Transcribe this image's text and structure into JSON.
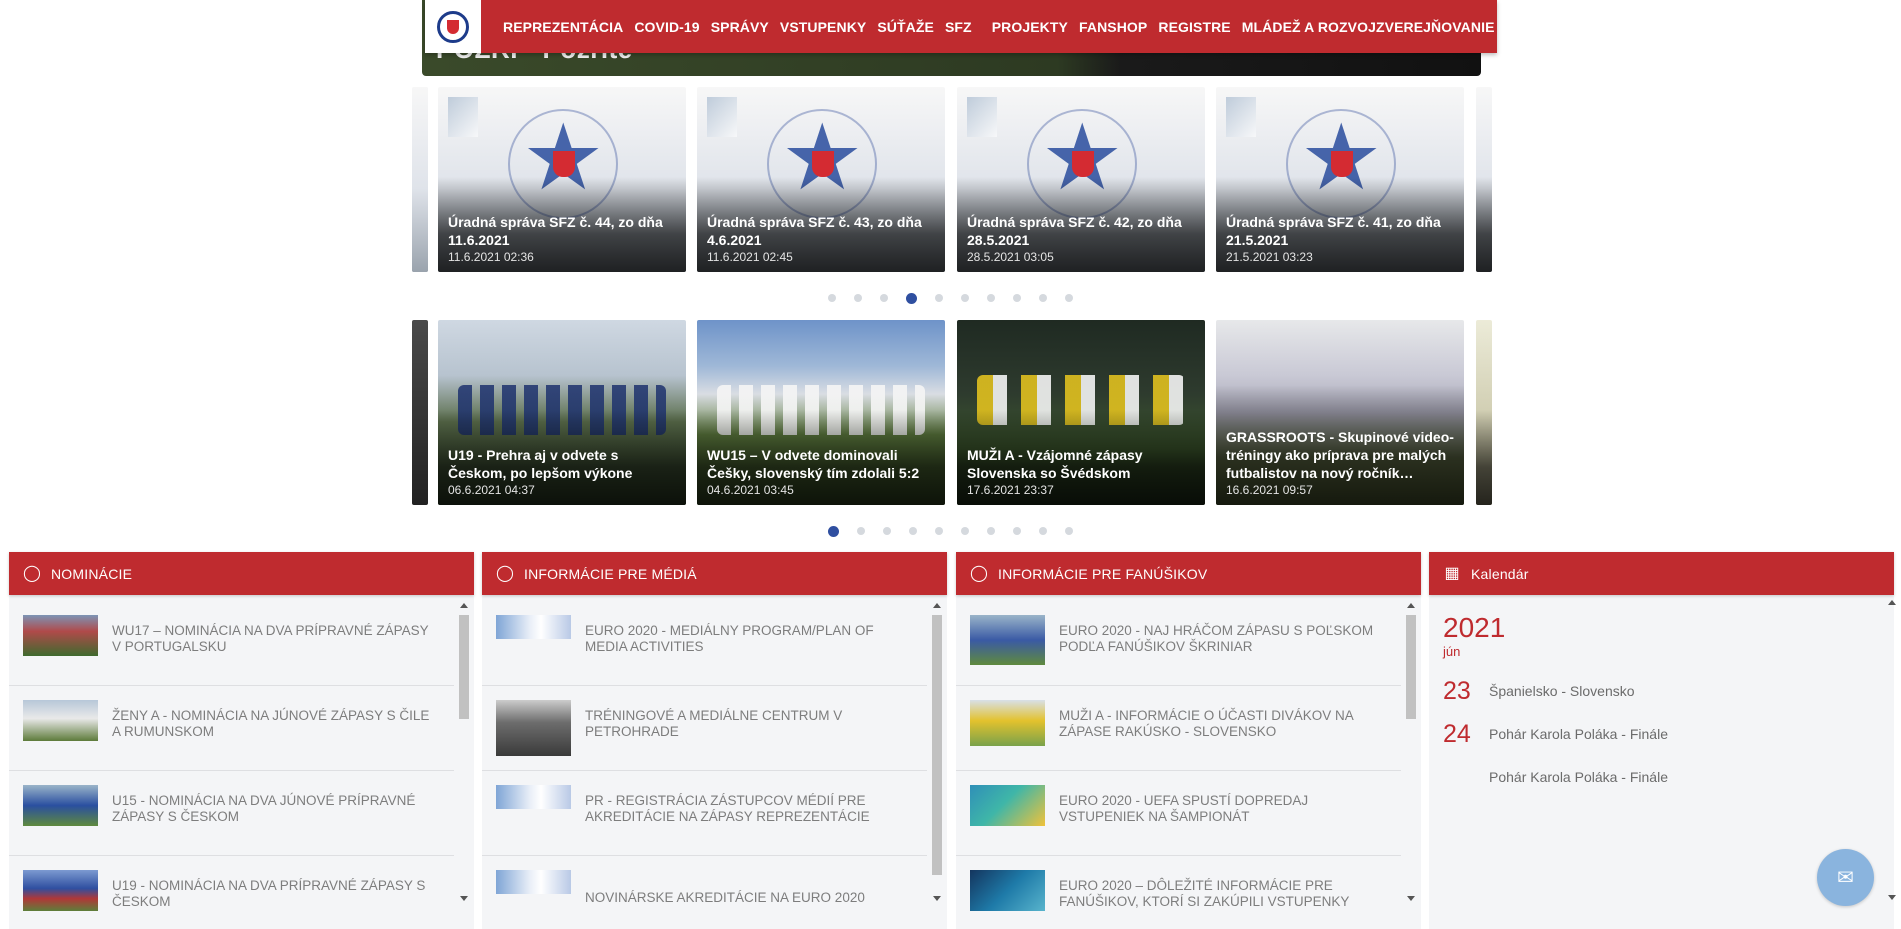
{
  "hero": {
    "text": "POZRI - Pozrite"
  },
  "nav": {
    "items": [
      "REPREZENTÁCIA",
      "COVID-19",
      "SPRÁVY",
      "VSTUPENKY",
      "SÚŤAŽE",
      "SFZ",
      "PROJEKTY",
      "FANSHOP",
      "REGISTRE",
      "MLÁDEŽ A ROZVOJ",
      "ZVEREJŇOVANIE"
    ]
  },
  "official_news": [
    {
      "title": "Úradná správa SFZ č. 44, zo dňa 11.6.2021",
      "date": "11.6.2021 02:36"
    },
    {
      "title": "Úradná správa SFZ č. 43, zo dňa 4.6.2021",
      "date": "11.6.2021 02:45"
    },
    {
      "title": "Úradná správa SFZ č. 42, zo dňa 28.5.2021",
      "date": "28.5.2021 03:05"
    },
    {
      "title": "Úradná správa SFZ č. 41, zo dňa 21.5.2021",
      "date": "21.5.2021 03:23"
    }
  ],
  "match_news": [
    {
      "title": "U19 - Prehra aj v odvete s Českom, po lepšom výkone",
      "date": "06.6.2021 04:37"
    },
    {
      "title": "WU15 – V odvete dominovali Češky, slovenský tím zdolali 5:2",
      "date": "04.6.2021 03:45"
    },
    {
      "title": "MUŽI A - Vzájomné zápasy Slovenska so Švédskom",
      "date": "17.6.2021 23:37"
    },
    {
      "title": "GRASSROOTS - Skupinové video-tréningy ako príprava pre malých futbalistov na nový ročník…",
      "date": "16.6.2021 09:57"
    }
  ],
  "carousel1_active": 3,
  "carousel2_active": 0,
  "dot_count": 10,
  "panels": {
    "nominacie": {
      "title": "NOMINÁCIE",
      "items": [
        "WU17 – NOMINÁCIA NA DVA PRÍPRAVNÉ ZÁPASY V PORTUGALSKU",
        "ŽENY A - NOMINÁCIA NA JÚNOVÉ ZÁPASY S ČILE A RUMUNSKOM",
        "U15 - NOMINÁCIA NA DVA JÚNOVÉ PRÍPRAVNÉ ZÁPASY S ČESKOM",
        "U19 - NOMINÁCIA NA DVA PRÍPRAVNÉ ZÁPASY S ČESKOM"
      ]
    },
    "media": {
      "title": "INFORMÁCIE PRE MÉDIÁ",
      "items": [
        "EURO 2020 - MEDIÁLNY PROGRAM/PLAN OF MEDIA ACTIVITIES",
        "TRÉNINGOVÉ A MEDIÁLNE CENTRUM V PETROHRADE",
        "PR - REGISTRÁCIA ZÁSTUPCOV MÉDIÍ PRE AKREDITÁCIE NA ZÁPASY REPREZENTÁCIE",
        "NOVINÁRSKE AKREDITÁCIE NA EURO 2020"
      ]
    },
    "fans": {
      "title": "INFORMÁCIE PRE FANÚŠIKOV",
      "items": [
        "EURO 2020 - NAJ HRÁČOM ZÁPASU S POĽSKOM PODĽA FANÚŠIKOV ŠKRINIAR",
        "MUŽI A - INFORMÁCIE O ÚČASTI DIVÁKOV NA ZÁPASE RAKÚSKO - SLOVENSKO",
        "EURO 2020 - UEFA SPUSTÍ DOPREDAJ VSTUPENIEK NA ŠAMPIONÁT",
        "EURO 2020 – DÔLEŽITÉ INFORMÁCIE PRE FANÚŠIKOV, KTORÍ SI ZAKÚPILI VSTUPENKY"
      ]
    }
  },
  "calendar": {
    "title": "Kalendár",
    "year": "2021",
    "month": "jún",
    "events": [
      {
        "day": "23",
        "name": "Španielsko - Slovensko"
      },
      {
        "day": "24",
        "name": "Pohár Karola Poláka - Finále"
      },
      {
        "day": "",
        "name": "Pohár Karola Poláka - Finále"
      }
    ]
  }
}
